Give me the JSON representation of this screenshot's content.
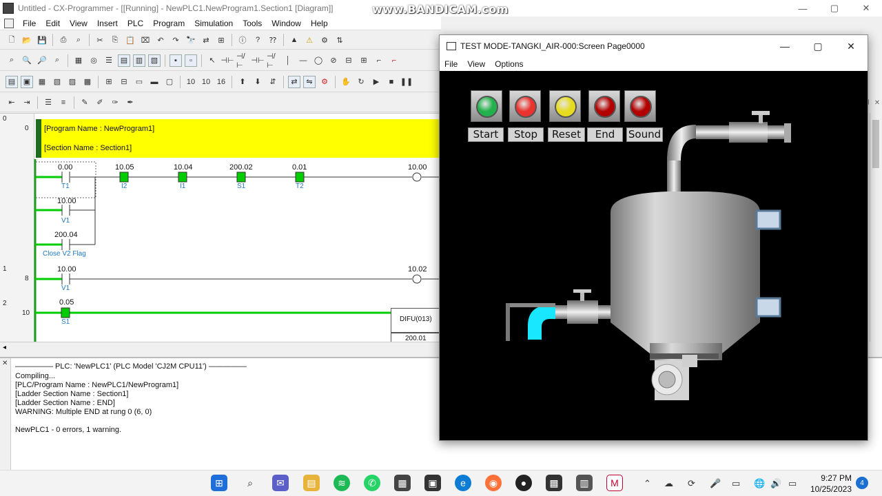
{
  "window": {
    "title": "Untitled - CX-Programmer - [[Running] - NewPLC1.NewProgram1.Section1 [Diagram]]",
    "controls": [
      "—",
      "▢",
      "✕"
    ]
  },
  "watermark": "www.BANDICAM.com",
  "menu": [
    "File",
    "Edit",
    "View",
    "Insert",
    "PLC",
    "Program",
    "Simulation",
    "Tools",
    "Window",
    "Help"
  ],
  "ladder": {
    "rung_numbers": [
      {
        "rung": "0",
        "step": "0"
      },
      {
        "rung": "1",
        "step": "8"
      },
      {
        "rung": "2",
        "step": "10"
      }
    ],
    "program_name": "[Program Name : NewProgram1]",
    "section_name": "[Section Name : Section1]",
    "rung0": {
      "contacts": [
        {
          "addr": "0.00",
          "sym": "T1"
        },
        {
          "addr": "10.05",
          "sym": "I2"
        },
        {
          "addr": "10.04",
          "sym": "I1"
        },
        {
          "addr": "200.02",
          "sym": "S1"
        },
        {
          "addr": "0.01",
          "sym": "T2"
        }
      ],
      "coil": "10.00",
      "branch1": {
        "addr": "10.00",
        "sym": "V1"
      },
      "branch2": {
        "addr": "200.04",
        "sym": "Close V2 Flag"
      }
    },
    "rung1": {
      "contact": {
        "addr": "10.00",
        "sym": "V1"
      },
      "coil": "10.02"
    },
    "rung2": {
      "contact": {
        "addr": "0.05",
        "sym": "S1"
      },
      "instr": "DIFU(013)",
      "operand": "200.01"
    }
  },
  "output": {
    "lines": [
      "————— PLC: 'NewPLC1' (PLC Model 'CJ2M CPU11') —————",
      "Compiling...",
      "[PLC/Program Name : NewPLC1/NewProgram1]",
      "[Ladder Section Name : Section1]",
      "[Ladder Section Name : END]",
      "WARNING: Multiple END at rung 0 (6, 0)",
      "",
      "NewPLC1 - 0 errors, 1 warning."
    ]
  },
  "hmi": {
    "title": "TEST MODE-TANGKI_AIR-000:Screen Page0000",
    "menu": [
      "File",
      "View",
      "Options"
    ],
    "buttons": [
      {
        "label": "Start",
        "color": "#22b14c"
      },
      {
        "label": "Stop",
        "color": "#e8332e"
      },
      {
        "label": "Reset",
        "color": "#e6db1f"
      },
      {
        "label": "End",
        "color": "#b20000"
      },
      {
        "label": "Sound",
        "color": "#b20000"
      }
    ],
    "water_color": "#19e6ff"
  },
  "taskbar": {
    "time": "9:27 PM",
    "date": "10/25/2023",
    "notifications": "4"
  }
}
